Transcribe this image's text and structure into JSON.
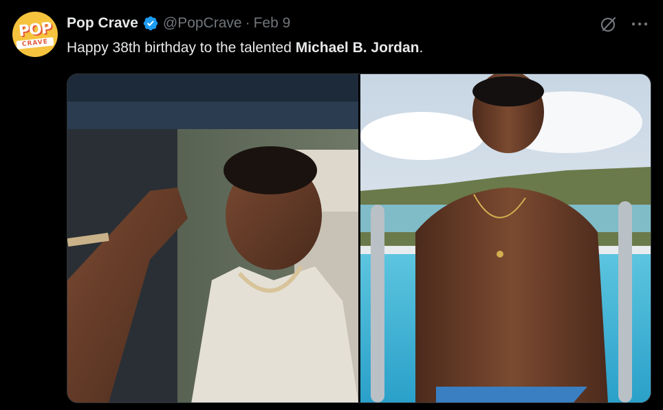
{
  "author": {
    "display_name": "Pop Crave",
    "handle": "@PopCrave",
    "separator": "·",
    "date": "Feb 9",
    "avatar_logo": {
      "top": "POP",
      "bottom": "CRAVE"
    }
  },
  "tweet": {
    "text_prefix": "Happy 38th birthday to the talented ",
    "text_bold": "Michael B. Jordan",
    "text_suffix": "."
  },
  "icons": {
    "verified": "verified-badge-icon",
    "grok": "grok-icon",
    "more": "more-icon"
  },
  "colors": {
    "background": "#000000",
    "text": "#e7e9ea",
    "muted": "#71767b",
    "verified": "#1d9bf0",
    "avatar": "#f6c33e"
  },
  "media": [
    {
      "name": "photo-car"
    },
    {
      "name": "photo-pool"
    }
  ]
}
